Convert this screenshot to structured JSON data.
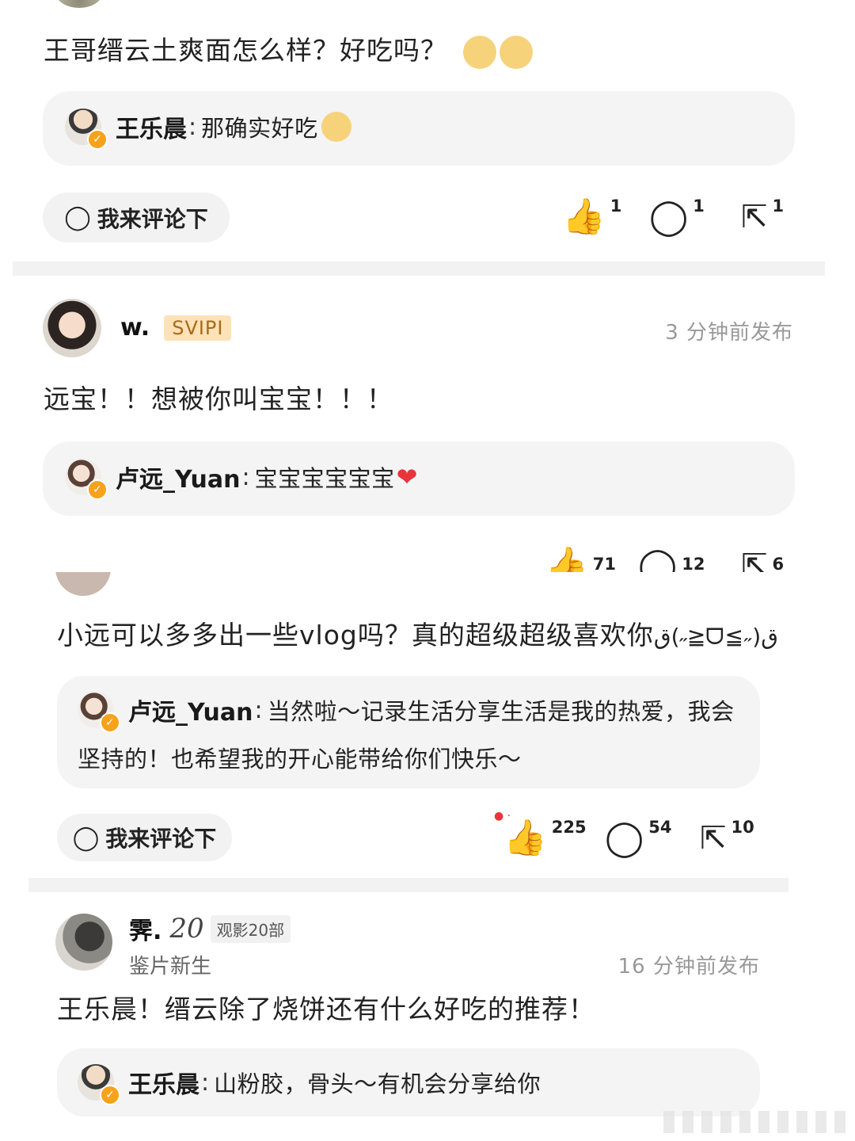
{
  "colors": {
    "accent_orange": "#f7a21b",
    "svip_bg": "#fde2b8",
    "like_yellow": "#f6b825",
    "reply_bg": "#f4f4f4"
  },
  "post1": {
    "text": "王哥缙云土爽面怎么样？好吃吗？",
    "emojis": [
      "doge-icon",
      "doge-icon"
    ],
    "reply": {
      "name": "王乐晨",
      "text": "那确实好吃",
      "emoji": "doge-icon"
    },
    "comment_button": "我来评论下",
    "likes": "1",
    "comments": "1",
    "shares": "1"
  },
  "post2": {
    "username": "w.",
    "badge": "SVIPI",
    "time": "3 分钟前发布",
    "text": "远宝！！想被你叫宝宝！！！",
    "reply": {
      "name": "卢远_Yuan",
      "text": "宝宝宝宝宝宝",
      "emoji": "heart-icon"
    },
    "likes": "71",
    "comments": "12",
    "shares": "6"
  },
  "post3": {
    "text": "小远可以多多出一些vlog吗？真的超级超级喜欢你",
    "kaomoji": "ق(˶≧ᗜ≦˶)ق",
    "reply": {
      "name": "卢远_Yuan",
      "text_line1": "当然啦～记录生活分享生活是我的热爱，我会",
      "text_line2": "坚持的！也希望我的开心能带给你们快乐～"
    },
    "comment_button": "我来评论下",
    "likes": "225",
    "comments": "54",
    "shares": "10"
  },
  "post4": {
    "username": "霁.",
    "level_number": "20",
    "level_tag": "观影20部",
    "subtitle": "鉴片新生",
    "time": "16 分钟前发布",
    "text": "王乐晨！缙云除了烧饼还有什么好吃的推荐！",
    "reply": {
      "name": "王乐晨",
      "text": "山粉胶，骨头～有机会分享给你"
    }
  },
  "icons": {
    "like": "👍",
    "comment": "◯",
    "share": "⇱",
    "bubble": "◯"
  }
}
